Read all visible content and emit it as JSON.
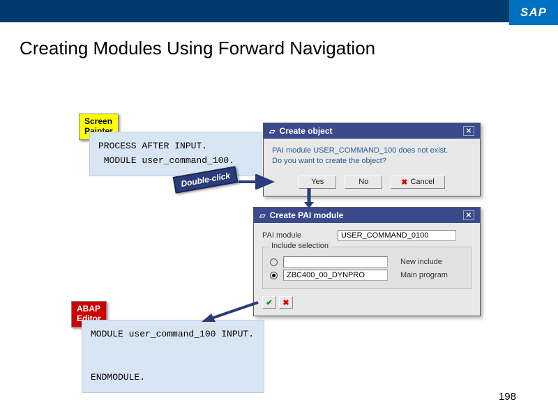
{
  "header": {
    "logo": "SAP"
  },
  "title": "Creating Modules Using Forward Navigation",
  "labels": {
    "screen_painter": "Screen\nPainter",
    "abap_editor": "ABAP\nEditor"
  },
  "code": {
    "screen": "PROCESS AFTER INPUT.\n MODULE user_command_100.",
    "editor": "MODULE user_command_100 INPUT.\n\n\nENDMODULE."
  },
  "annotation": {
    "double_click": "Double-click"
  },
  "dialog1": {
    "title": "Create object",
    "message_line1": "PAI module USER_COMMAND_100 does not exist.",
    "message_line2": "Do you want to create the object?",
    "btn_yes": "Yes",
    "btn_no": "No",
    "btn_cancel": "Cancel"
  },
  "dialog2": {
    "title": "Create PAI module",
    "field_label": "PAI module",
    "field_value": "USER_COMMAND_0100",
    "group_title": "Include selection",
    "opt1_value": "",
    "opt1_label": "New include",
    "opt2_value": "ZBC400_00_DYNPRO",
    "opt2_label": "Main program",
    "opt2_checked": true
  },
  "page": "198"
}
